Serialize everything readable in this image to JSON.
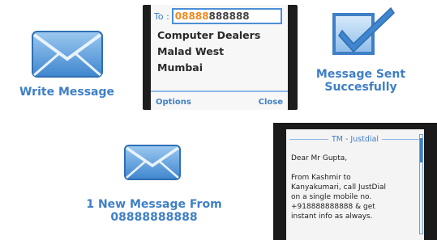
{
  "step1": {
    "caption": "Write Message",
    "icon": "envelope-icon"
  },
  "compose": {
    "to_label": "To :",
    "to_value_highlight": "08888",
    "to_value_rest": "888888",
    "address_lines": [
      "Computer Dealers",
      "Malad West",
      "Mumbai"
    ],
    "left_softkey": "Options",
    "right_softkey": "Close"
  },
  "step2": {
    "caption_line1": "Message Sent",
    "caption_line2": "Succesfully",
    "icon": "checkbox-check-icon"
  },
  "step3": {
    "caption_line1": "1 New Message From",
    "caption_line2": "08888888888",
    "icon": "envelope-icon"
  },
  "inbox": {
    "title": "TM - Justdial",
    "greeting": "Dear Mr Gupta,",
    "body_lines": [
      "From Kashmir to",
      "Kanyakumari, call JustDial",
      "on a single mobile no.",
      "+918888888888 & get",
      "instant info as always."
    ]
  },
  "colors": {
    "accent_blue": "#3f7fc6",
    "highlight_orange": "#f08a1e",
    "phone_black": "#1d1d1d"
  }
}
